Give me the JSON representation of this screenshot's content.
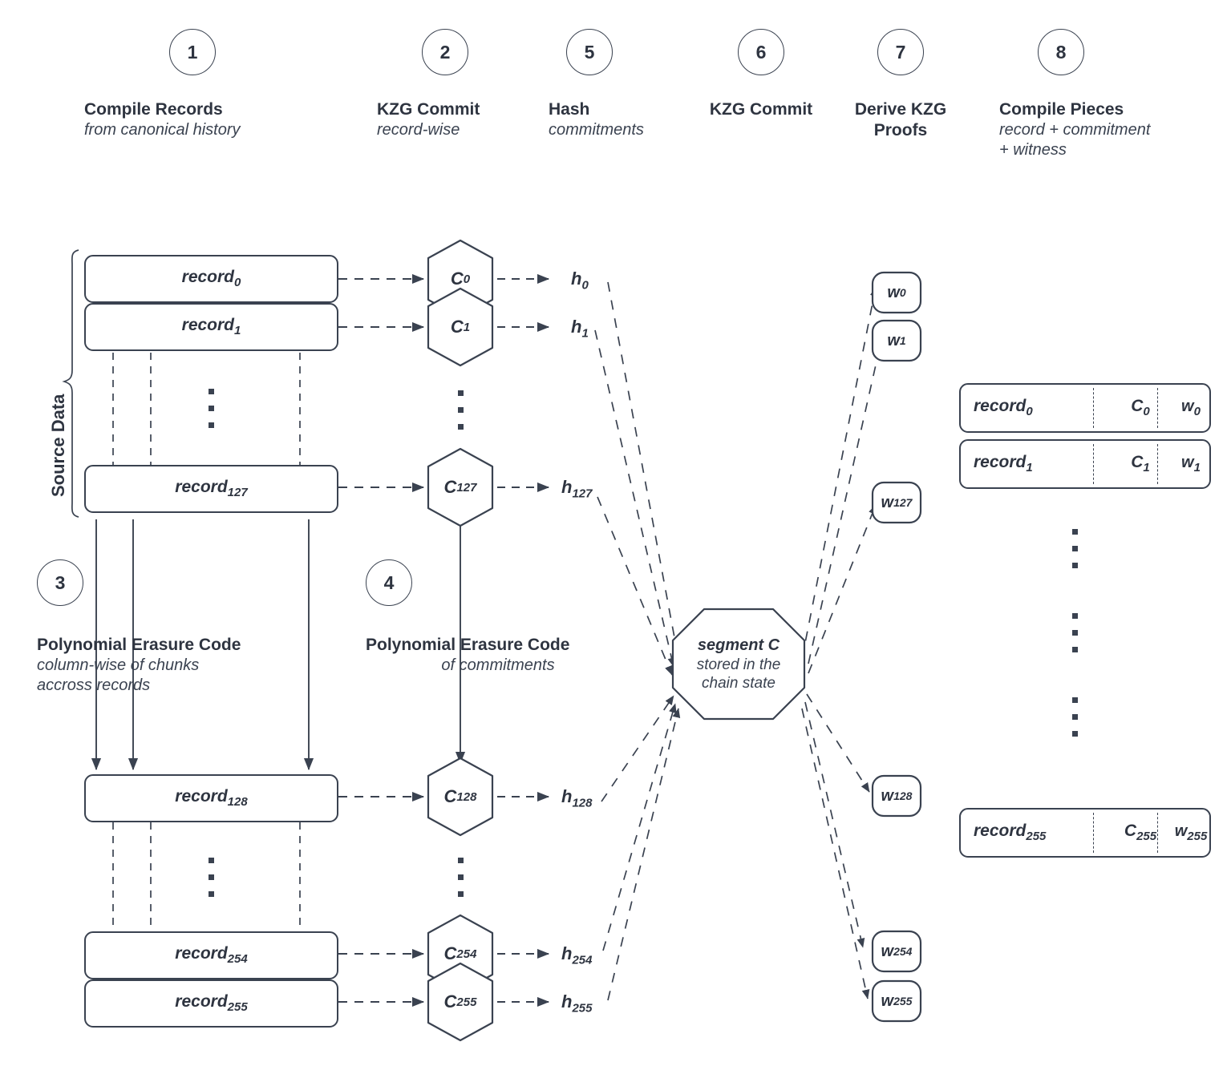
{
  "steps": [
    {
      "n": "1",
      "title": "Compile Records",
      "sub": "from canonical history"
    },
    {
      "n": "2",
      "title": "KZG Commit",
      "sub": "record-wise"
    },
    {
      "n": "5",
      "title": "Hash",
      "sub": "commitments"
    },
    {
      "n": "6",
      "title": "KZG Commit",
      "sub": ""
    },
    {
      "n": "7",
      "title": "Derive KZG\nProofs",
      "sub": ""
    },
    {
      "n": "8",
      "title": "Compile Pieces",
      "sub": "record + commitment\n+ witness"
    },
    {
      "n": "3",
      "title": "Polynomial Erasure Code",
      "sub": "column-wise of chunks\naccross records"
    },
    {
      "n": "4",
      "title": "Polynomial Erasure Code",
      "sub": "of commitments"
    }
  ],
  "source_data_label": "Source Data",
  "records": [
    {
      "name": "record",
      "idx": "0"
    },
    {
      "name": "record",
      "idx": "1"
    },
    {
      "name": "record",
      "idx": "127"
    },
    {
      "name": "record",
      "idx": "128"
    },
    {
      "name": "record",
      "idx": "254"
    },
    {
      "name": "record",
      "idx": "255"
    }
  ],
  "commitments": [
    {
      "name": "C",
      "idx": "0"
    },
    {
      "name": "C",
      "idx": "1"
    },
    {
      "name": "C",
      "idx": "127"
    },
    {
      "name": "C",
      "idx": "128"
    },
    {
      "name": "C",
      "idx": "254"
    },
    {
      "name": "C",
      "idx": "255"
    }
  ],
  "hashes": [
    {
      "name": "h",
      "idx": "0"
    },
    {
      "name": "h",
      "idx": "1"
    },
    {
      "name": "h",
      "idx": "127"
    },
    {
      "name": "h",
      "idx": "128"
    },
    {
      "name": "h",
      "idx": "254"
    },
    {
      "name": "h",
      "idx": "255"
    }
  ],
  "witnesses": [
    {
      "name": "w",
      "idx": "0"
    },
    {
      "name": "w",
      "idx": "1"
    },
    {
      "name": "w",
      "idx": "127"
    },
    {
      "name": "w",
      "idx": "128"
    },
    {
      "name": "w",
      "idx": "254"
    },
    {
      "name": "w",
      "idx": "255"
    }
  ],
  "segment": {
    "title": "segment C",
    "sub_line1": "stored in the",
    "sub_line2": "chain state"
  },
  "pieces": [
    {
      "record": "record",
      "record_idx": "0",
      "commitment": "C",
      "commitment_idx": "0",
      "witness": "w",
      "witness_idx": "0"
    },
    {
      "record": "record",
      "record_idx": "1",
      "commitment": "C",
      "commitment_idx": "1",
      "witness": "w",
      "witness_idx": "1"
    },
    {
      "record": "record",
      "record_idx": "255",
      "commitment": "C",
      "commitment_idx": "255",
      "witness": "w",
      "witness_idx": "255"
    }
  ],
  "colors": {
    "stroke": "#3a4250",
    "text": "#2e3440",
    "background": "#ffffff"
  }
}
